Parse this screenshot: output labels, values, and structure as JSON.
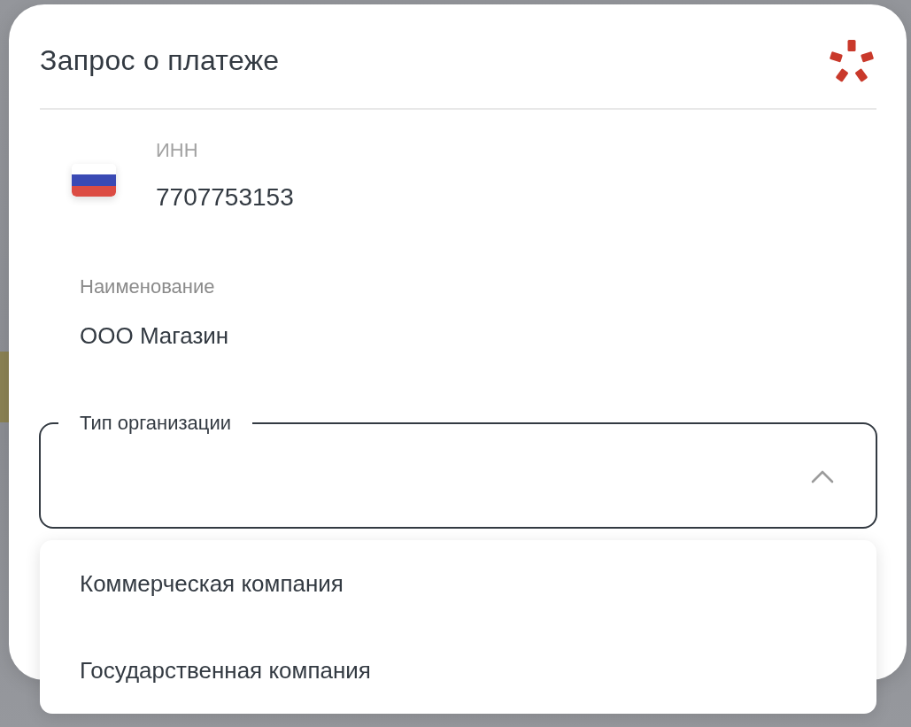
{
  "dialog": {
    "title": "Запрос о платеже"
  },
  "inn": {
    "label": "ИНН",
    "value": "7707753153"
  },
  "name": {
    "label": "Наименование",
    "value": "ООО Магазин"
  },
  "organization_type": {
    "label": "Тип организации",
    "expanded": true,
    "options": [
      {
        "label": "Коммерческая компания",
        "selected": false
      },
      {
        "label": "Государственная компания",
        "selected": false
      }
    ]
  }
}
